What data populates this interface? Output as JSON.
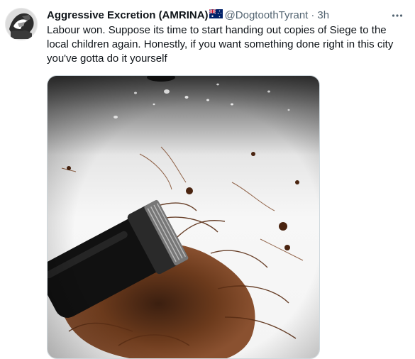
{
  "tweet": {
    "author": {
      "display_name": "Aggressive Excretion (AMRINA)",
      "flag_icon": "australia-flag-icon",
      "handle": "@DogtoothTyrant",
      "separator": "·",
      "time": "3h"
    },
    "more_icon": "more-horizontal-icon",
    "text": "Labour won. Suppose its time to start handing out copies of Siege to the local children again. Honestly, if you want something done right in this city you've gotta do it yourself",
    "media": {
      "subject": "hair-clippers-with-hair-clippings-in-sink"
    }
  },
  "colors": {
    "text_primary": "#0f1419",
    "text_secondary": "#536471",
    "border": "#cfd9de"
  }
}
